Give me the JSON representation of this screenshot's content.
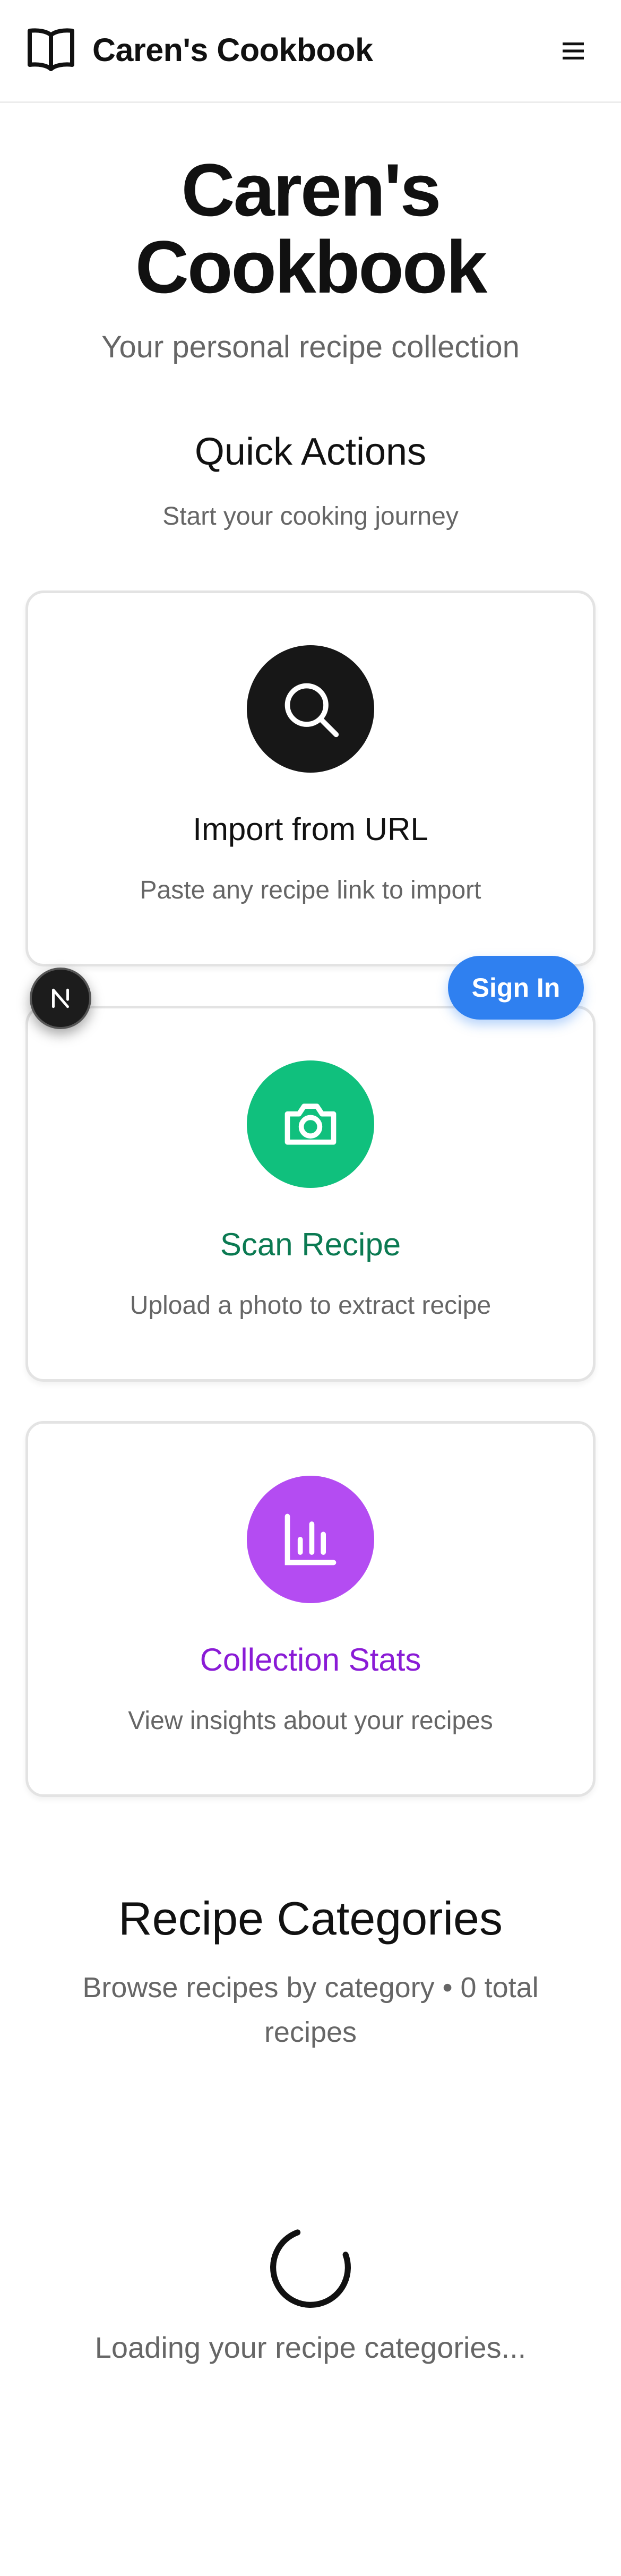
{
  "header": {
    "app_title": "Caren's Cookbook",
    "logo_icon": "open-book-icon",
    "menu_icon": "hamburger-menu-icon"
  },
  "hero": {
    "title": "Caren's Cookbook",
    "subtitle": "Your personal recipe collection"
  },
  "quick_actions": {
    "title": "Quick Actions",
    "subtitle": "Start your cooking journey",
    "cards": [
      {
        "icon": "search-icon",
        "title": "Import from URL",
        "description": "Paste any recipe link to import",
        "icon_bg": "#171717",
        "title_color": "#111111"
      },
      {
        "icon": "camera-icon",
        "title": "Scan Recipe",
        "description": "Upload a photo to extract recipe",
        "icon_bg": "#10c07d",
        "title_color": "#0b7a52"
      },
      {
        "icon": "bar-chart-icon",
        "title": "Collection Stats",
        "description": "View insights about your recipes",
        "icon_bg": "#b44cf2",
        "title_color": "#8a1bd6"
      }
    ]
  },
  "categories": {
    "title": "Recipe Categories",
    "subtitle_line1": "Browse recipes by category • 0 total",
    "subtitle_line2": "recipes",
    "loading_text": "Loading your recipe categories..."
  },
  "overlay": {
    "sign_in_label": "Sign In",
    "badge_icon": "next-logo-icon",
    "accent_color": "#2f80f0"
  }
}
